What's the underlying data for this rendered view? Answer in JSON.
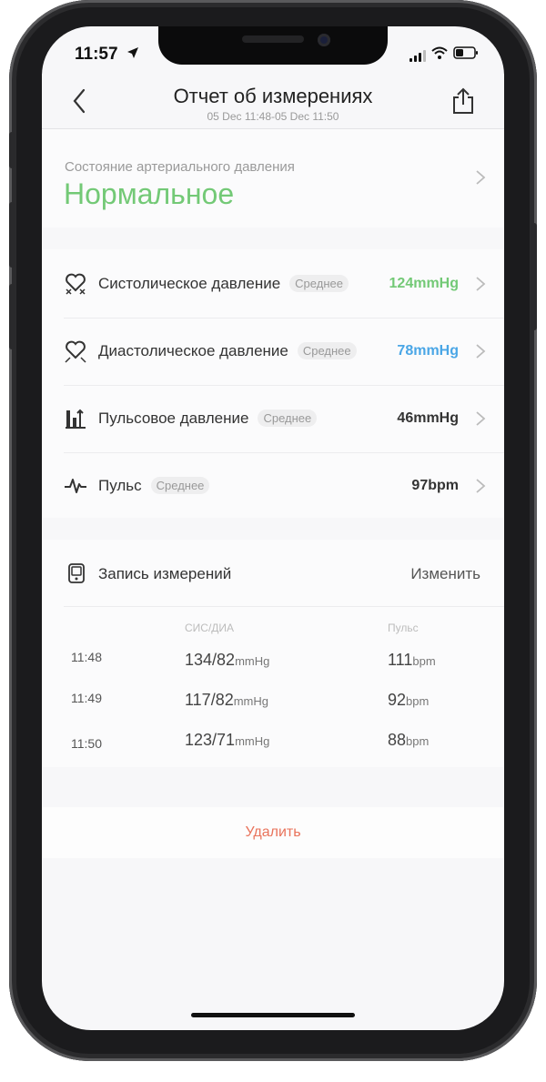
{
  "status": {
    "time": "11:57"
  },
  "nav": {
    "title": "Отчет об измерениях",
    "subtitle": "05 Dec 11:48-05 Dec 11:50"
  },
  "bp_state": {
    "label": "Состояние артериального давления",
    "value": "Нормальное",
    "color": "#73c976"
  },
  "metrics": [
    {
      "label": "Систолическое давление",
      "badge": "Среднее",
      "value": "124mmHg",
      "color": "#73c976",
      "icon": "heart-compress-icon"
    },
    {
      "label": "Диастолическое давление",
      "badge": "Среднее",
      "value": "78mmHg",
      "color": "#4aa6e6",
      "icon": "heart-expand-icon"
    },
    {
      "label": "Пульсовое давление",
      "badge": "Среднее",
      "value": "46mmHg",
      "color": "#333333",
      "icon": "pressure-bars-icon"
    },
    {
      "label": "Пульс",
      "badge": "Среднее",
      "value": "97bpm",
      "color": "#333333",
      "icon": "pulse-wave-icon"
    }
  ],
  "records": {
    "title": "Запись измерений",
    "edit": "Изменить",
    "headers": {
      "bp": "СИС/ДИА",
      "pulse": "Пульс"
    },
    "rows": [
      {
        "time": "11:48",
        "bp": "134/82",
        "bp_unit": "mmHg",
        "pulse": "111",
        "pulse_unit": "bpm"
      },
      {
        "time": "11:49",
        "bp": "117/82",
        "bp_unit": "mmHg",
        "pulse": "92",
        "pulse_unit": "bpm"
      },
      {
        "time": "11:50",
        "bp": "123/71",
        "bp_unit": "mmHg",
        "pulse": "88",
        "pulse_unit": "bpm"
      }
    ]
  },
  "delete_label": "Удалить"
}
